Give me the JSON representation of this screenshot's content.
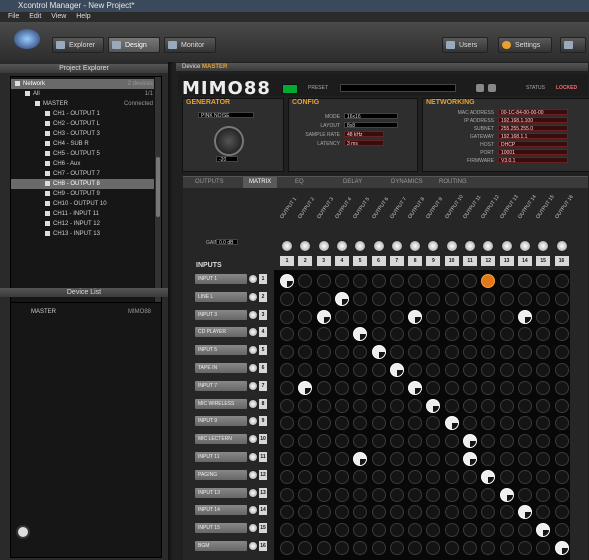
{
  "window": {
    "title": "Xcontrol Manager - New Project*"
  },
  "menu": [
    "File",
    "Edit",
    "View",
    "Help"
  ],
  "toolbar": {
    "buttons": [
      {
        "label": "Explorer",
        "selected": false
      },
      {
        "label": "Design",
        "selected": true
      },
      {
        "label": "Monitor",
        "selected": false
      }
    ],
    "right_buttons": [
      "Users",
      "Settings"
    ]
  },
  "project_explorer": {
    "title": "Project Explorer",
    "items": [
      {
        "label": "Network",
        "right": "2 devices",
        "indent": 0,
        "highlight": true
      },
      {
        "label": "All",
        "right": "1/1",
        "indent": 1
      },
      {
        "label": "MASTER",
        "right": "Connected",
        "indent": 2
      },
      {
        "label": "CH1 - OUTPUT 1",
        "indent": 3
      },
      {
        "label": "CH2 - OUTPUT L",
        "indent": 3
      },
      {
        "label": "CH3 - OUTPUT 3",
        "indent": 3
      },
      {
        "label": "CH4 - SUB R",
        "indent": 3
      },
      {
        "label": "CH5 - OUTPUT 5",
        "indent": 3
      },
      {
        "label": "CH6 - Aux",
        "indent": 3
      },
      {
        "label": "CH7 - OUTPUT 7",
        "indent": 3
      },
      {
        "label": "CH8 - OUTPUT 8",
        "indent": 3,
        "highlight": true
      },
      {
        "label": "CH9 - OUTPUT 9",
        "indent": 3
      },
      {
        "label": "CH10 - OUTPUT 10",
        "indent": 3
      },
      {
        "label": "CH11 - INPUT 11",
        "indent": 3
      },
      {
        "label": "CH12 - INPUT 12",
        "indent": 3
      },
      {
        "label": "CH13 - INPUT 13",
        "indent": 3
      }
    ]
  },
  "device_list": {
    "title": "Device List",
    "items": [
      {
        "label": "MASTER",
        "right": "MIMO88"
      }
    ]
  },
  "device_tab": {
    "prefix": "Device",
    "name": "MASTER"
  },
  "device": {
    "model": "MIMO88",
    "preset_label": "PRESET",
    "status_label": "LOCKED",
    "status_value": "LOCKED"
  },
  "generator": {
    "title": "GENERATOR",
    "mode": "PINK NOISE",
    "level": "-20"
  },
  "config": {
    "title": "CONFIG",
    "fields": [
      {
        "label": "MODE",
        "value": "16x16"
      },
      {
        "label": "LAYOUT",
        "value": "8x8"
      },
      {
        "label": "SAMPLE RATE",
        "value": "48 kHz"
      },
      {
        "label": "LATENCY",
        "value": "3 ms"
      }
    ]
  },
  "networking": {
    "title": "NETWORKING",
    "fields": [
      {
        "label": "MAC ADDRESS",
        "value": "00-1C-84-00-00-00"
      },
      {
        "label": "IP ADDRESS",
        "value": "192.168.1.100"
      },
      {
        "label": "SUBNET",
        "value": "255.255.255.0"
      },
      {
        "label": "GATEWAY",
        "value": "192.168.1.1"
      },
      {
        "label": "HOST",
        "value": "DHCP"
      },
      {
        "label": "PORT",
        "value": "10001"
      },
      {
        "label": "FIRMWARE",
        "value": "V3.0.1"
      }
    ]
  },
  "tabs": [
    "OUTPUTS",
    "MATRIX",
    "EQ",
    "DELAY",
    "DYNAMICS",
    "ROUTING"
  ],
  "tabs_selected": 1,
  "matrix": {
    "inputs_label": "INPUTS",
    "gain_label": "GAIN",
    "gain_value": "0.0 dB",
    "columns": 16,
    "column_numbers": [
      "1",
      "2",
      "3",
      "4",
      "5",
      "6",
      "7",
      "8",
      "9",
      "10",
      "11",
      "12",
      "13",
      "14",
      "15",
      "16"
    ],
    "column_labels": [
      "OUTPUT 1",
      "OUTPUT 2",
      "OUTPUT 3",
      "OUTPUT 4",
      "OUTPUT 5",
      "OUTPUT 6",
      "OUTPUT 7",
      "OUTPUT 8",
      "OUTPUT 9",
      "OUTPUT 10",
      "OUTPUT 11",
      "OUTPUT 12",
      "OUTPUT 13",
      "OUTPUT 14",
      "OUTPUT 15",
      "OUTPUT 16"
    ],
    "rows": [
      {
        "name": "INPUT 1",
        "num": "1"
      },
      {
        "name": "LINE L",
        "num": "2"
      },
      {
        "name": "INPUT 3",
        "num": "3"
      },
      {
        "name": "CD PLAYER",
        "num": "4"
      },
      {
        "name": "INPUT 5",
        "num": "5"
      },
      {
        "name": "TAPE IN",
        "num": "6"
      },
      {
        "name": "INPUT 7",
        "num": "7"
      },
      {
        "name": "MIC WIRELESS",
        "num": "8"
      },
      {
        "name": "INPUT 9",
        "num": "9"
      },
      {
        "name": "MIC LECTERN",
        "num": "10"
      },
      {
        "name": "INPUT 11",
        "num": "11"
      },
      {
        "name": "PAGING",
        "num": "12"
      },
      {
        "name": "INPUT 13",
        "num": "13"
      },
      {
        "name": "INPUT 14",
        "num": "14"
      },
      {
        "name": "INPUT 15",
        "num": "15"
      },
      {
        "name": "BGM",
        "num": "16"
      }
    ],
    "active": [
      [
        0,
        0
      ],
      [
        1,
        3
      ],
      [
        2,
        2
      ],
      [
        2,
        7
      ],
      [
        2,
        13
      ],
      [
        3,
        4
      ],
      [
        4,
        5
      ],
      [
        5,
        6
      ],
      [
        6,
        1
      ],
      [
        6,
        7
      ],
      [
        7,
        8
      ],
      [
        8,
        9
      ],
      [
        9,
        10
      ],
      [
        10,
        4
      ],
      [
        10,
        10
      ],
      [
        11,
        11
      ],
      [
        12,
        12
      ],
      [
        13,
        13
      ],
      [
        14,
        14
      ],
      [
        15,
        15
      ]
    ],
    "highlight_orange": [
      [
        0,
        11
      ]
    ]
  },
  "colors": {
    "accent": "#e8a030",
    "orange": "#e07818",
    "network_red": "#3a0c0c"
  }
}
